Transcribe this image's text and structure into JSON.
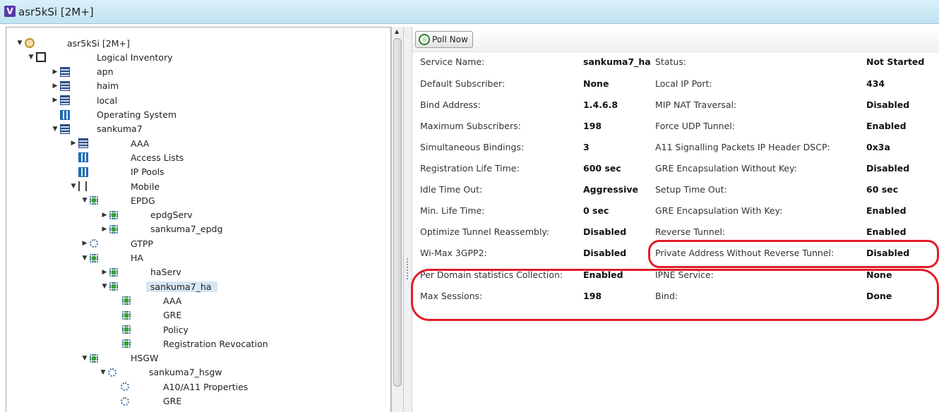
{
  "window": {
    "logo": "V",
    "title": "asr5kSi [2M+]"
  },
  "toolbar": {
    "poll_label": "Poll Now"
  },
  "tree": [
    {
      "label": "asr5kSi [2M+]",
      "expanded": true,
      "icon": "device-root-icon"
    },
    {
      "label": "Logical Inventory",
      "expanded": true,
      "icon": "inventory-doc-icon"
    },
    {
      "label": "apn",
      "expanded": false,
      "icon": "context-icon"
    },
    {
      "label": "haim",
      "expanded": false,
      "icon": "context-icon"
    },
    {
      "label": "local",
      "expanded": false,
      "icon": "context-icon"
    },
    {
      "label": "Operating System",
      "expanded": null,
      "icon": "os-icon"
    },
    {
      "label": "sankuma7",
      "expanded": true,
      "icon": "context-icon"
    },
    {
      "label": "AAA",
      "expanded": false,
      "icon": "aaa-icon"
    },
    {
      "label": "Access Lists",
      "expanded": null,
      "icon": "list-icon"
    },
    {
      "label": "IP Pools",
      "expanded": null,
      "icon": "list-icon"
    },
    {
      "label": "Mobile",
      "expanded": true,
      "icon": "mobile-antenna-icon"
    },
    {
      "label": "EPDG",
      "expanded": true,
      "icon": "service-icon"
    },
    {
      "label": "epdgServ",
      "expanded": false,
      "icon": "service-icon"
    },
    {
      "label": "sankuma7_epdg",
      "expanded": false,
      "icon": "service-icon"
    },
    {
      "label": "GTPP",
      "expanded": false,
      "icon": "gear-icon"
    },
    {
      "label": "HA",
      "expanded": true,
      "icon": "service-icon"
    },
    {
      "label": "haServ",
      "expanded": false,
      "icon": "service-icon"
    },
    {
      "label": "sankuma7_ha",
      "expanded": true,
      "icon": "service-icon",
      "selected": true
    },
    {
      "label": "AAA",
      "expanded": null,
      "icon": "service-icon"
    },
    {
      "label": "GRE",
      "expanded": null,
      "icon": "service-icon"
    },
    {
      "label": "Policy",
      "expanded": null,
      "icon": "service-icon"
    },
    {
      "label": "Registration Revocation",
      "expanded": null,
      "icon": "service-icon"
    },
    {
      "label": "HSGW",
      "expanded": true,
      "icon": "service-icon"
    },
    {
      "label": "sankuma7_hsgw",
      "expanded": true,
      "icon": "gear-icon"
    },
    {
      "label": "A10/A11 Properties",
      "expanded": null,
      "icon": "gear-icon"
    },
    {
      "label": "GRE",
      "expanded": null,
      "icon": "gear-icon"
    }
  ],
  "properties": {
    "left": [
      {
        "label": "Service Name:",
        "value": "sankuma7_ha"
      },
      {
        "label": "Default Subscriber:",
        "value": "None"
      },
      {
        "label": "Bind Address:",
        "value": "1.4.6.8"
      },
      {
        "label": "Maximum Subscribers:",
        "value": "198"
      },
      {
        "label": "Simultaneous Bindings:",
        "value": "3"
      },
      {
        "label": "Registration Life Time:",
        "value": "600 sec"
      },
      {
        "label": "Idle Time Out:",
        "value": "Aggressive"
      },
      {
        "label": "Min. Life Time:",
        "value": "0 sec"
      },
      {
        "label": "Optimize Tunnel Reassembly:",
        "value": "Disabled"
      },
      {
        "label": "Wi-Max 3GPP2:",
        "value": "Disabled"
      },
      {
        "label": "Per Domain statistics Collection:",
        "value": "Enabled"
      },
      {
        "label": "Max Sessions:",
        "value": "198"
      }
    ],
    "right": [
      {
        "label": "Status:",
        "value": "Not Started"
      },
      {
        "label": "Local IP Port:",
        "value": "434"
      },
      {
        "label": "MIP NAT Traversal:",
        "value": "Disabled"
      },
      {
        "label": "Force UDP Tunnel:",
        "value": "Enabled"
      },
      {
        "label": "A11 Signalling Packets IP Header DSCP:",
        "value": "0x3a"
      },
      {
        "label": "GRE Encapsulation Without Key:",
        "value": "Disabled"
      },
      {
        "label": "Setup Time Out:",
        "value": "60 sec"
      },
      {
        "label": "GRE Encapsulation With Key:",
        "value": "Enabled"
      },
      {
        "label": "Reverse Tunnel:",
        "value": "Enabled"
      },
      {
        "label": "Private Address Without Reverse Tunnel:",
        "value": "Disabled"
      },
      {
        "label": "IPNE Service:",
        "value": "None"
      },
      {
        "label": "Bind:",
        "value": "Done"
      }
    ]
  },
  "colors": {
    "highlight": "#e01d2a",
    "selection": "#d7e6f3"
  }
}
